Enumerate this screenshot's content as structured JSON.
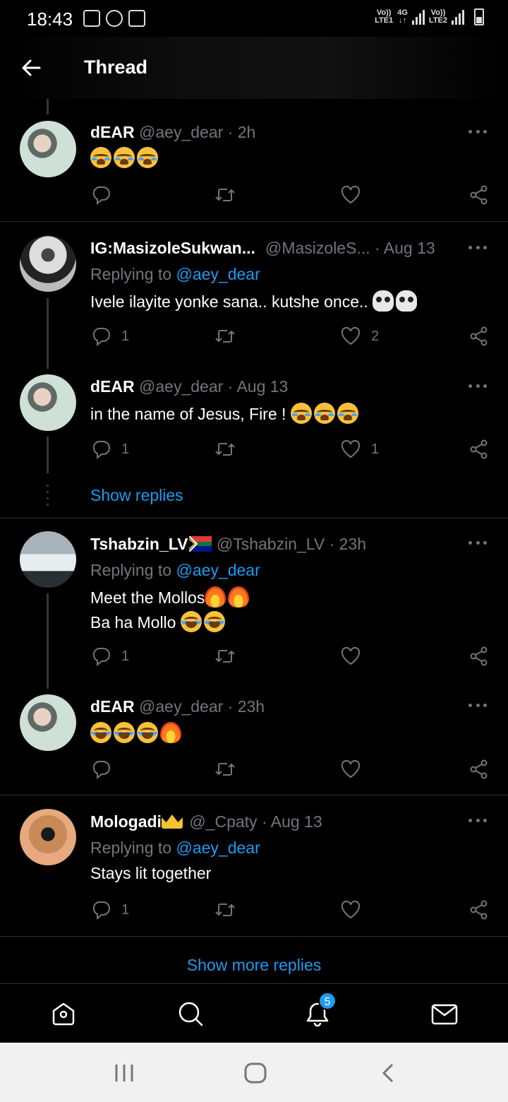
{
  "status_bar": {
    "time": "18:43",
    "sim1_label_top": "Vo))",
    "sim1_label_bottom": "LTE1",
    "net_top": "4G",
    "net_bottom": "↓↑",
    "sim2_label_top": "Vo))",
    "sim2_label_bottom": "LTE2"
  },
  "header": {
    "title": "Thread"
  },
  "tweets": [
    {
      "name": "dEAR",
      "handle": "@aey_dear",
      "time": "· 2h",
      "text": "",
      "replies": "",
      "likes": ""
    },
    {
      "name": "IG:MasizoleSukwan...",
      "handle": "@MasizoleS...",
      "time": "· Aug 13",
      "replying_prefix": "Replying to",
      "replying_to": "@aey_dear",
      "text": "Ivele ilayite yonke sana.. kutshe once..",
      "replies": "1",
      "likes": "2"
    },
    {
      "name": "dEAR",
      "handle": "@aey_dear",
      "time": "· Aug 13",
      "text": "in the name of Jesus, Fire !",
      "replies": "1",
      "likes": "1"
    },
    {
      "name": "Tshabzin_LV",
      "handle": "@Tshabzin_LV",
      "time": "· 23h",
      "replying_prefix": "Replying to",
      "replying_to": "@aey_dear",
      "text": "Meet the Mollos",
      "text2": "Ba ha Mollo",
      "replies": "1",
      "likes": ""
    },
    {
      "name": "dEAR",
      "handle": "@aey_dear",
      "time": "· 23h",
      "text": "",
      "replies": "",
      "likes": ""
    },
    {
      "name": "Mologadi",
      "handle": "@_Cpaty",
      "time": "· Aug 13",
      "replying_prefix": "Replying to",
      "replying_to": "@aey_dear",
      "text": "Stays lit together",
      "replies": "1",
      "likes": ""
    }
  ],
  "show_replies": "Show replies",
  "show_more_replies": "Show more replies",
  "nav": {
    "notifications_badge": "5"
  },
  "icons": [
    "back-arrow-icon",
    "more-icon",
    "reply-icon",
    "retweet-icon",
    "like-icon",
    "share-icon",
    "home-icon",
    "search-icon",
    "bell-icon",
    "mail-icon"
  ],
  "colors": {
    "accent": "#1d9bf0",
    "background": "#000000",
    "muted": "#71767b"
  }
}
